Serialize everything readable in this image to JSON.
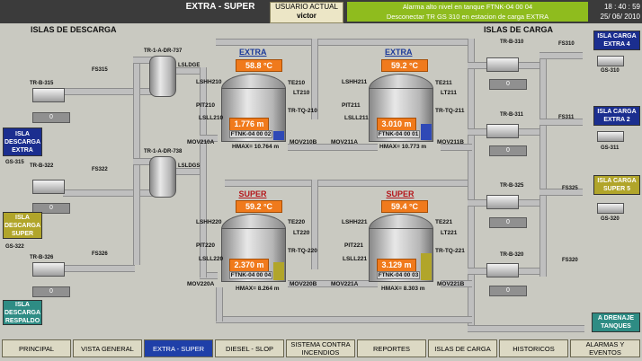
{
  "header": {
    "screen_title": "EXTRA - SUPER",
    "user_label": "USUARIO ACTUAL",
    "user_name": "victor",
    "alarm_1": "Alarma alto nivel en tanque FTNK-04 00 04",
    "alarm_2": "Desconectar TR GS 310 en estacion de carga EXTRA",
    "time": "18 : 40 : 59",
    "date": "25/ 06/ 2010"
  },
  "sections": {
    "descarga": "ISLAS DE DESCARGA",
    "carga": "ISLAS DE CARGA"
  },
  "tanks": [
    {
      "title": "EXTRA",
      "temp": "58.8 °C",
      "level": "1.776 m",
      "id": "FTNK-04 00 02",
      "hmax": "HMAX= 10.764 m",
      "tags": {
        "ls_hh": "LSHH210",
        "pit": "PIT210",
        "ls_ll": "LSLL210",
        "te": "TE210",
        "lt": "LT210",
        "tr": "TR-TQ-210",
        "mov_a": "MOV210A",
        "mov_b": "MOV210B"
      }
    },
    {
      "title": "EXTRA",
      "temp": "59.2 °C",
      "level": "3.010 m",
      "id": "FTNK-04 00 01",
      "hmax": "HMAX= 10.773 m",
      "tags": {
        "ls_hh": "LSHH211",
        "pit": "PIT211",
        "ls_ll": "LSLL211",
        "te": "TE211",
        "lt": "LT211",
        "tr": "TR-TQ-211",
        "mov_a": "MOV211A",
        "mov_b": "MOV211B"
      }
    },
    {
      "title": "SUPER",
      "temp": "59.2 °C",
      "level": "2.370 m",
      "id": "FTNK-04 00 04",
      "hmax": "HMAX= 8.264 m",
      "tags": {
        "ls_hh": "LSHH220",
        "pit": "PIT220",
        "ls_ll": "LSLL220",
        "te": "TE220",
        "lt": "LT220",
        "tr": "TR-TQ-220",
        "mov_a": "MOV220A",
        "mov_b": "MOV220B"
      }
    },
    {
      "title": "SUPER",
      "temp": "59.4 °C",
      "level": "3.129 m",
      "id": "FTNK-04 00 03",
      "hmax": "HMAX= 8.303 m",
      "tags": {
        "ls_hh": "LSHH221",
        "pit": "PIT221",
        "ls_ll": "LSLL221",
        "te": "TE221",
        "lt": "LT221",
        "tr": "TR-TQ-221",
        "mov_a": "MOV221A",
        "mov_b": "MOV221B"
      }
    }
  ],
  "filters": [
    {
      "tag": "TR-1-A-DR-737",
      "ls": "LSLDGE"
    },
    {
      "tag": "TR-1-A-DR-738",
      "ls": "LSLDGS"
    }
  ],
  "left_pumps": [
    {
      "tr": "TR-B-315",
      "fs": "FS315",
      "value": "0"
    },
    {
      "tr": "TR-B-322",
      "fs": "FS322",
      "value": "0"
    },
    {
      "tr": "TR-B-326",
      "fs": "FS326",
      "value": "0"
    }
  ],
  "right_pumps": [
    {
      "tr": "TR-B-310",
      "fs": "FS310",
      "value": "0"
    },
    {
      "tr": "TR-B-311",
      "fs": "FS311",
      "value": "0"
    },
    {
      "tr": "TR-B-325",
      "fs": "FS325",
      "value": "0"
    },
    {
      "tr": "TR-B-320",
      "fs": "FS320",
      "value": "0"
    }
  ],
  "left_islands": [
    {
      "label": "ISLA DESCARGA EXTRA",
      "gs": "GS-315",
      "color": "#1b2e8f"
    },
    {
      "label": "ISLA DESCARGA SUPER",
      "gs": "GS-322",
      "color": "#b1a52a"
    },
    {
      "label": "ISLA DESCARGA RESPALDO",
      "gs": "",
      "color": "#2e8c84"
    }
  ],
  "right_islands": [
    {
      "label": "ISLA CARGA EXTRA 4",
      "gs": "GS-310",
      "color": "#1b2e8f"
    },
    {
      "label": "ISLA CARGA EXTRA 2",
      "gs": "GS-311",
      "color": "#1b2e8f"
    },
    {
      "label": "ISLA CARGA SUPER 5",
      "gs": "GS-320",
      "color": "#b1a52a"
    }
  ],
  "drain_label": "A DRENAJE TANQUES",
  "nav": [
    {
      "label": "PRINCIPAL",
      "active": false
    },
    {
      "label": "VISTA GENERAL",
      "active": false
    },
    {
      "label": "EXTRA - SUPER",
      "active": true
    },
    {
      "label": "DIESEL - SLOP",
      "active": false
    },
    {
      "label": "SISTEMA CONTRA INCENDIOS",
      "active": false
    },
    {
      "label": "REPORTES",
      "active": false
    },
    {
      "label": "ISLAS DE CARGA",
      "active": false
    },
    {
      "label": "HISTORICOS",
      "active": false
    },
    {
      "label": "ALARMAS Y EVENTOS",
      "active": false
    }
  ]
}
